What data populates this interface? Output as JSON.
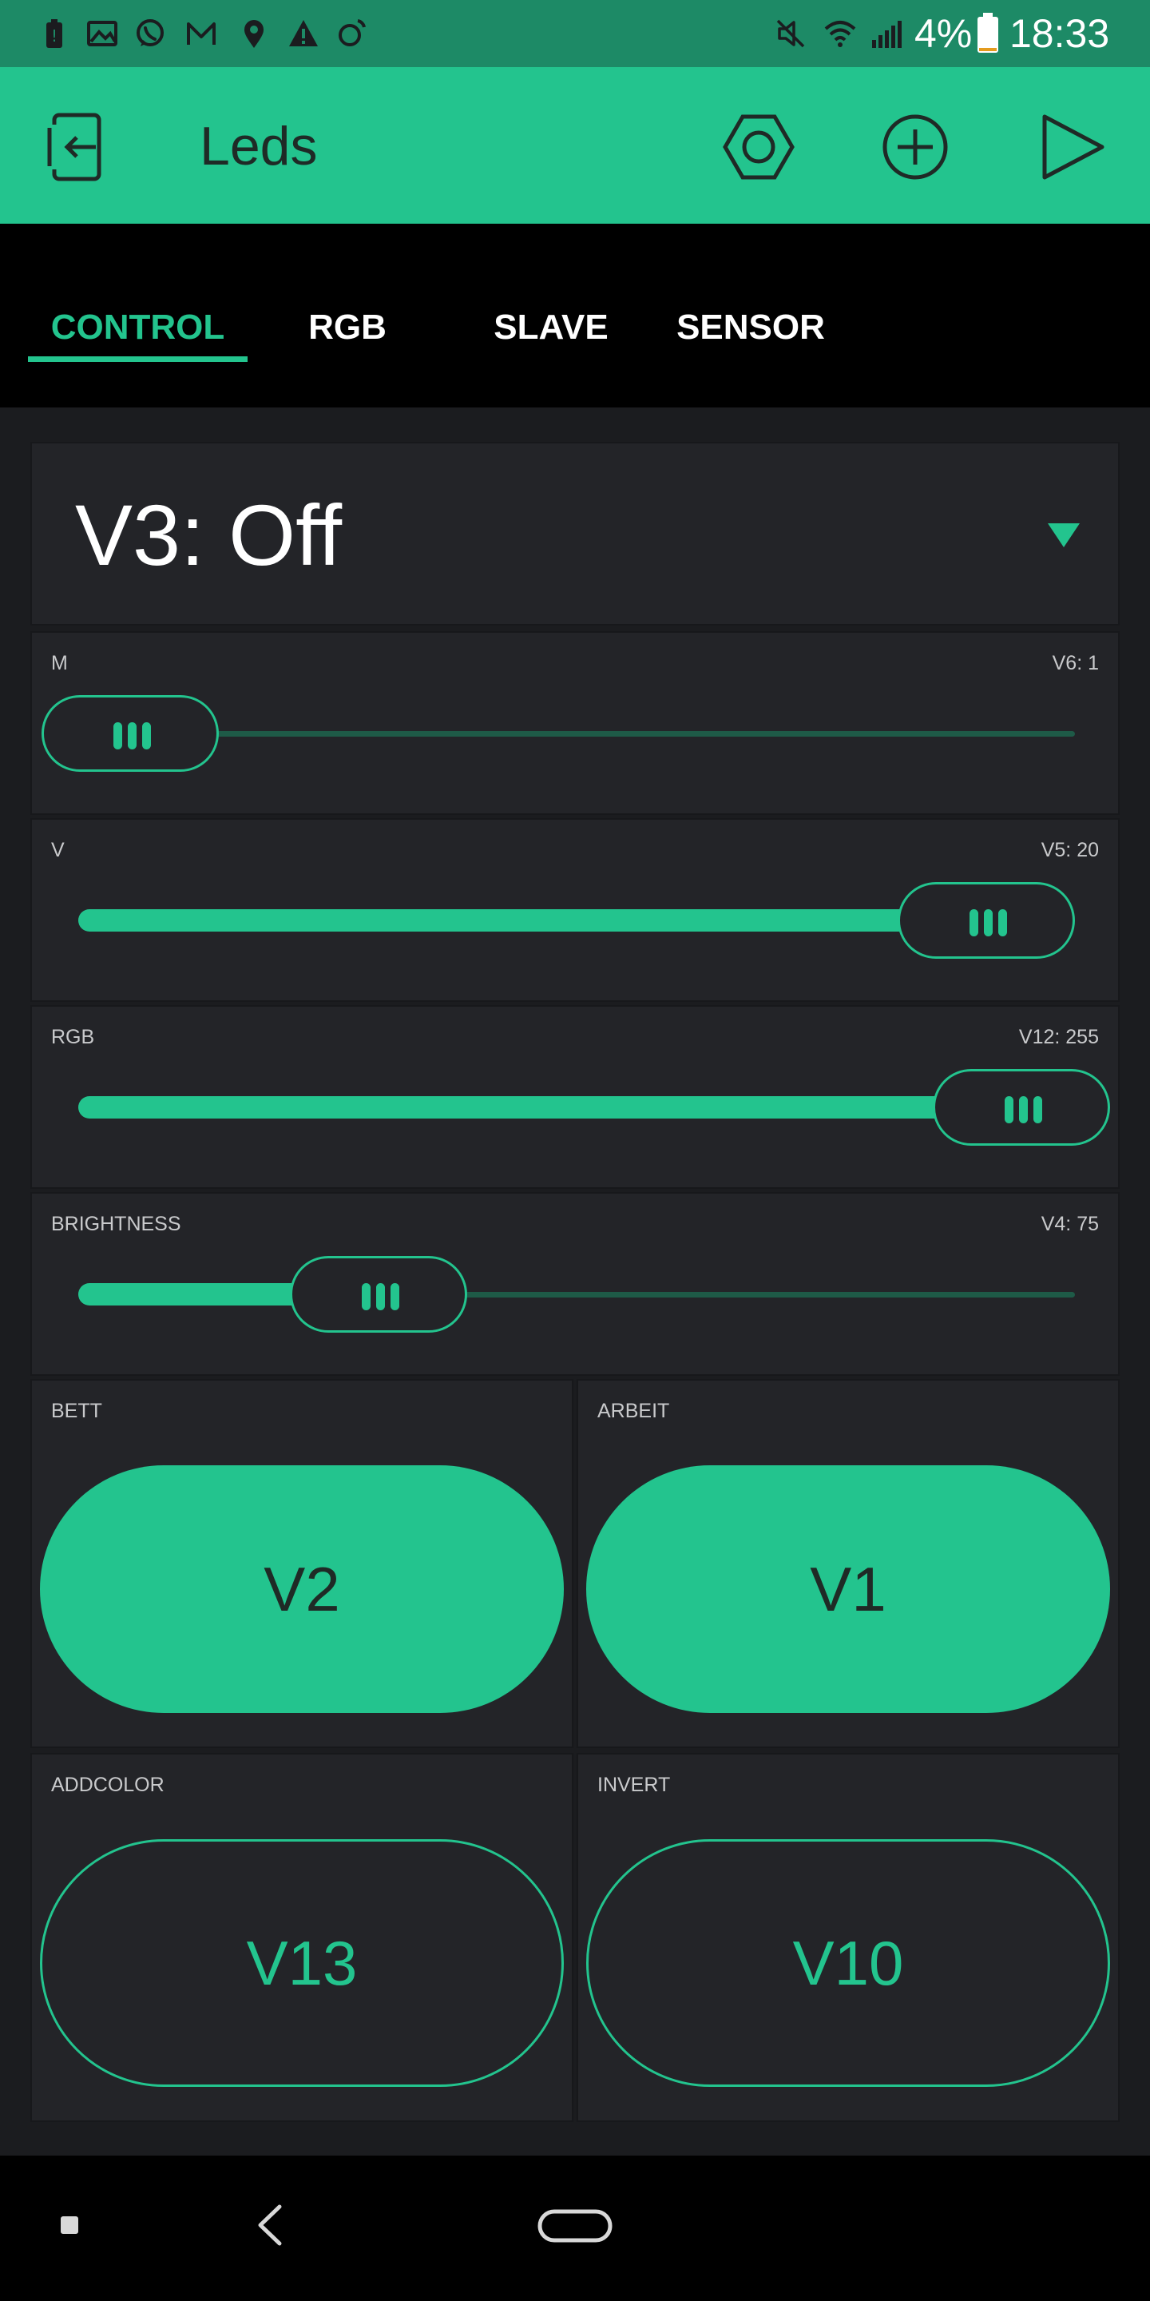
{
  "status_bar": {
    "battery_percent": "4%",
    "time": "18:33",
    "left_icons": [
      "notification-battery-icon",
      "gallery-icon",
      "whatsapp-icon",
      "gmail-icon",
      "location-icon",
      "warning-icon",
      "sync-icon"
    ],
    "right_icons": [
      "mute-icon",
      "wifi-icon",
      "signal-icon",
      "battery-icon"
    ]
  },
  "app_bar": {
    "title": "Leds",
    "buttons": [
      "exit-icon",
      "settings-hexagon-icon",
      "add-widget-icon",
      "play-icon"
    ]
  },
  "tabs": [
    {
      "label": "CONTROL",
      "active": true
    },
    {
      "label": "RGB",
      "active": false
    },
    {
      "label": "SLAVE",
      "active": false
    },
    {
      "label": "SENSOR",
      "active": false
    }
  ],
  "dropdown": {
    "text": "V3: Off"
  },
  "sliders": [
    {
      "label": "M",
      "value_text": "V6: 1",
      "level": 0.0
    },
    {
      "label": "V",
      "value_text": "V5: 20",
      "level": 1.0
    },
    {
      "label": "RGB",
      "value_text": "V12: 255",
      "level": 1.0
    },
    {
      "label": "BRIGHTNESS",
      "value_text": "V4: 75",
      "level": 0.29
    }
  ],
  "buttons": [
    {
      "label": "BETT",
      "pin": "V2",
      "state": "on"
    },
    {
      "label": "ARBEIT",
      "pin": "V1",
      "state": "on"
    },
    {
      "label": "ADDCOLOR",
      "pin": "V13",
      "state": "off"
    },
    {
      "label": "INVERT",
      "pin": "V10",
      "state": "off"
    }
  ],
  "colors": {
    "accent": "#23c48e",
    "status_bar": "#1d8a66",
    "widget_bg": "#232428",
    "dashboard_bg": "#1b1c1f"
  }
}
